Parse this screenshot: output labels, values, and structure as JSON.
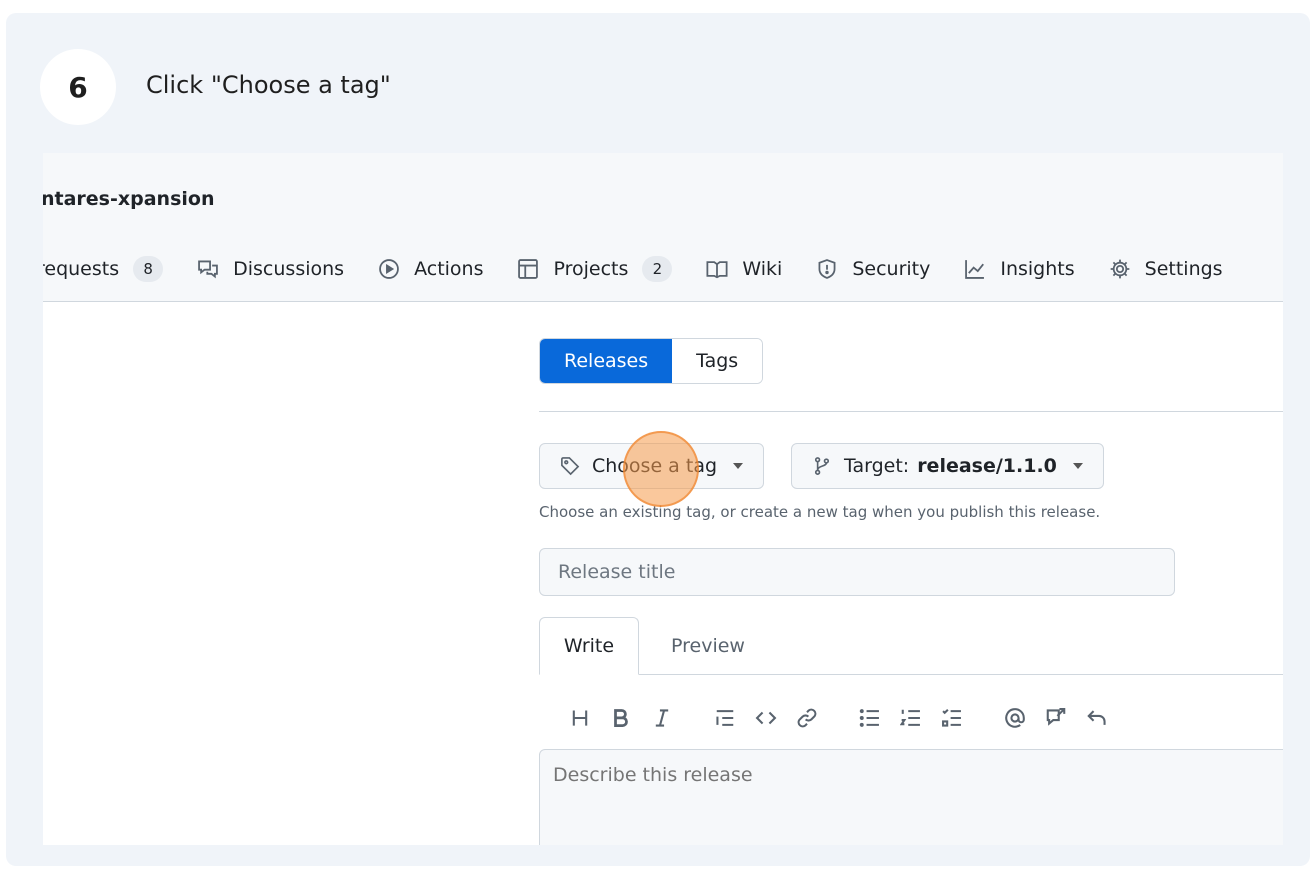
{
  "step": {
    "number": "6",
    "instruction": "Click \"Choose a tag\""
  },
  "repo": {
    "name": "ntares-xpansion"
  },
  "nav": {
    "items": [
      {
        "label": "requests",
        "counter": "8",
        "icon": "pull-request-icon"
      },
      {
        "label": "Discussions",
        "icon": "discussions-icon"
      },
      {
        "label": "Actions",
        "icon": "play-icon"
      },
      {
        "label": "Projects",
        "counter": "2",
        "icon": "table-icon"
      },
      {
        "label": "Wiki",
        "icon": "book-icon"
      },
      {
        "label": "Security",
        "icon": "shield-icon"
      },
      {
        "label": "Insights",
        "icon": "graph-icon"
      },
      {
        "label": "Settings",
        "icon": "gear-icon"
      }
    ]
  },
  "segmented": {
    "releases": "Releases",
    "tags": "Tags"
  },
  "form": {
    "choose_tag": "Choose a tag",
    "target_label": "Target:",
    "target_value": "release/1.1.0",
    "hint": "Choose an existing tag, or create a new tag when you publish this release.",
    "title_placeholder": "Release title",
    "tab_write": "Write",
    "tab_preview": "Preview",
    "body_placeholder": "Describe this release"
  },
  "colors": {
    "accent": "#0969da",
    "click_marker": "#f59a4a",
    "card_bg": "#f0f4f9"
  }
}
